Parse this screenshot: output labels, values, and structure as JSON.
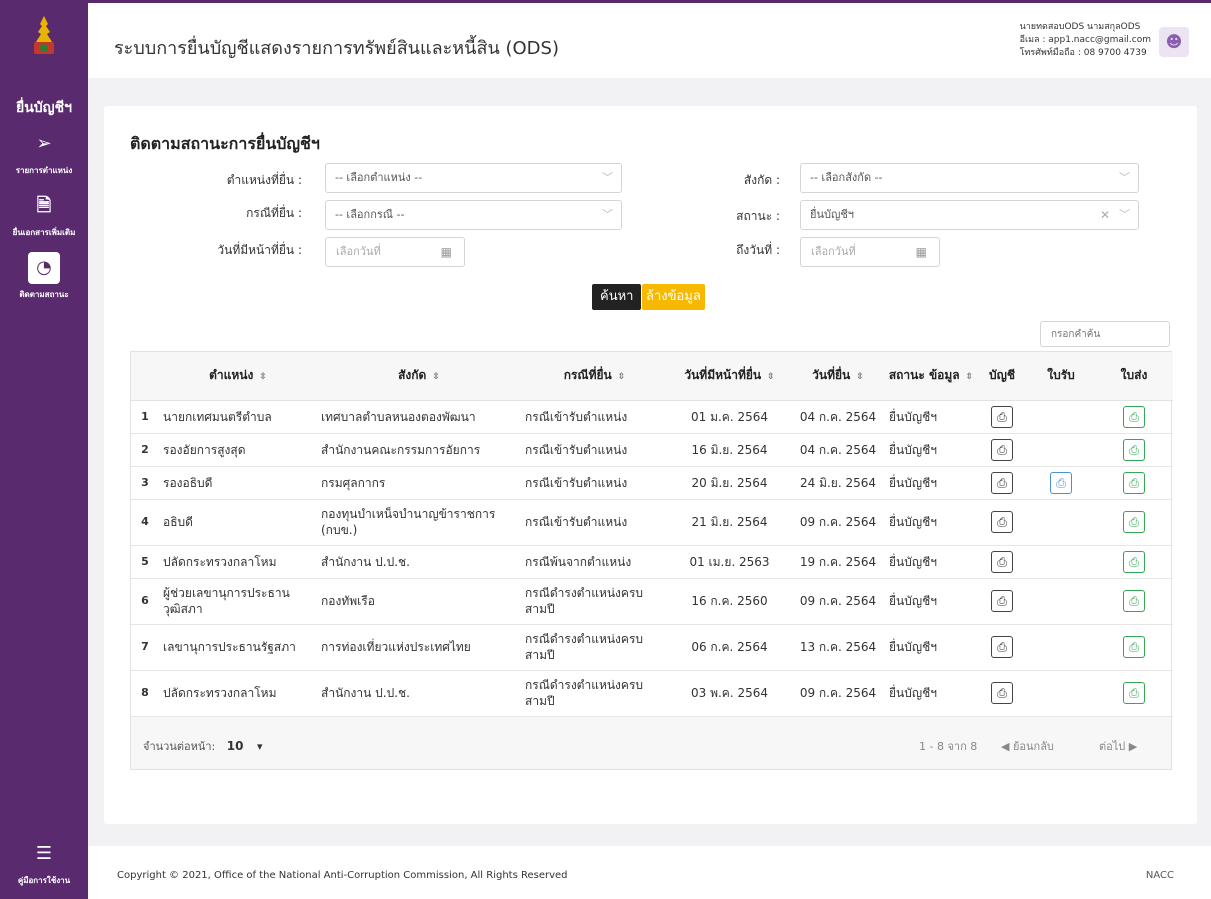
{
  "sidebar": {
    "title": "ยื่นบัญชีฯ",
    "items": [
      {
        "label": "รายการตำแหน่ง",
        "icon": "send-icon"
      },
      {
        "label": "ยื่นเอกสารเพิ่มเติม",
        "icon": "document-add-icon"
      },
      {
        "label": "ติดตามสถานะ",
        "icon": "track-status-icon"
      }
    ],
    "manual_label": "คู่มือการใช้งาน"
  },
  "header": {
    "title": "ระบบการยื่นบัญชีแสดงรายการทรัพย์สินและหนี้สิน (ODS)",
    "user_name": "นายทดสอบODS นามสกุลODS",
    "user_email": "อีเมล : app1.nacc@gmail.com",
    "user_phone": "โทรศัพท์มือถือ : 08 9700 4739"
  },
  "filters": {
    "title": "ติดตามสถานะการยื่นบัญชีฯ",
    "position_label": "ตำแหน่งที่ยื่น :",
    "position_value": "-- เลือกตำแหน่ง --",
    "case_label": "กรณีที่ยื่น :",
    "case_value": "-- เลือกกรณี --",
    "due_date_label": "วันที่มีหน้าที่ยื่น :",
    "due_date_placeholder": "เลือกวันที่",
    "agency_label": "สังกัด :",
    "agency_value": "-- เลือกสังกัด --",
    "status_label": "สถานะ :",
    "status_value": "ยื่นบัญชีฯ",
    "to_date_label": "ถึงวันที่ :",
    "to_date_placeholder": "เลือกวันที่",
    "search_button": "ค้นหา",
    "clear_button": "ล้างข้อมูล",
    "keyword_placeholder": "กรอกคำค้น"
  },
  "table": {
    "headers": [
      "ตำแหน่ง",
      "สังกัด",
      "กรณีที่ยื่น",
      "วันที่มีหน้าที่ยื่น",
      "วันที่ยื่น",
      "สถานะ ข้อมูล",
      "บัญชี",
      "ใบรับ",
      "ใบส่ง"
    ],
    "rows": [
      {
        "no": "1",
        "position": "นายกเทศมนตรีตำบล",
        "agency": "เทศบาลตำบลหนองตองพัฒนา",
        "case": "กรณีเข้ารับตำแหน่ง",
        "due": "01 ม.ค. 2564",
        "filed": "04 ก.ค. 2564",
        "status": "ยื่นบัญชีฯ",
        "receipt": false
      },
      {
        "no": "2",
        "position": "รองอัยการสูงสุด",
        "agency": "สำนักงานคณะกรรมการอัยการ",
        "case": "กรณีเข้ารับตำแหน่ง",
        "due": "16 มิ.ย. 2564",
        "filed": "04 ก.ค. 2564",
        "status": "ยื่นบัญชีฯ",
        "receipt": false
      },
      {
        "no": "3",
        "position": "รองอธิบดี",
        "agency": "กรมศุลกากร",
        "case": "กรณีเข้ารับตำแหน่ง",
        "due": "20 มิ.ย. 2564",
        "filed": "24 มิ.ย. 2564",
        "status": "ยื่นบัญชีฯ",
        "receipt": true
      },
      {
        "no": "4",
        "position": "อธิบดี",
        "agency": "กองทุนบำเหน็จบำนาญข้าราชการ (กบข.)",
        "case": "กรณีเข้ารับตำแหน่ง",
        "due": "21 มิ.ย. 2564",
        "filed": "09 ก.ค. 2564",
        "status": "ยื่นบัญชีฯ",
        "receipt": false
      },
      {
        "no": "5",
        "position": "ปลัดกระทรวงกลาโหม",
        "agency": "สำนักงาน ป.ป.ช.",
        "case": "กรณีพ้นจากตำแหน่ง",
        "due": "01 เม.ย. 2563",
        "filed": "19 ก.ค. 2564",
        "status": "ยื่นบัญชีฯ",
        "receipt": false
      },
      {
        "no": "6",
        "position": "ผู้ช่วยเลขานุการประธานวุฒิสภา",
        "agency": "กองทัพเรือ",
        "case": "กรณีดำรงตำแหน่งครบสามปี",
        "due": "16 ก.ค. 2560",
        "filed": "09 ก.ค. 2564",
        "status": "ยื่นบัญชีฯ",
        "receipt": false
      },
      {
        "no": "7",
        "position": "เลขานุการประธานรัฐสภา",
        "agency": "การท่องเที่ยวแห่งประเทศไทย",
        "case": "กรณีดำรงตำแหน่งครบสามปี",
        "due": "06 ก.ค. 2564",
        "filed": "13 ก.ค. 2564",
        "status": "ยื่นบัญชีฯ",
        "receipt": false
      },
      {
        "no": "8",
        "position": "ปลัดกระทรวงกลาโหม",
        "agency": "สำนักงาน ป.ป.ช.",
        "case": "กรณีดำรงตำแหน่งครบสามปี",
        "due": "03 พ.ค. 2564",
        "filed": "09 ก.ค. 2564",
        "status": "ยื่นบัญชีฯ",
        "receipt": false
      }
    ],
    "per_page_label": "จำนวนต่อหน้า:",
    "per_page_value": "10",
    "range_text": "1 - 8 จาก 8",
    "prev_label": "◀  ย้อนกลับ",
    "next_label": "ต่อไป  ▶"
  },
  "footer": {
    "copyright": "Copyright © 2021, Office of the National Anti-Corruption Commission, All Rights Reserved",
    "brand": "NACC"
  },
  "colors": {
    "sidebar": "#5a2a6e",
    "accent_yellow": "#f6b800",
    "print_green": "#34a853",
    "print_blue": "#4a90d9"
  }
}
